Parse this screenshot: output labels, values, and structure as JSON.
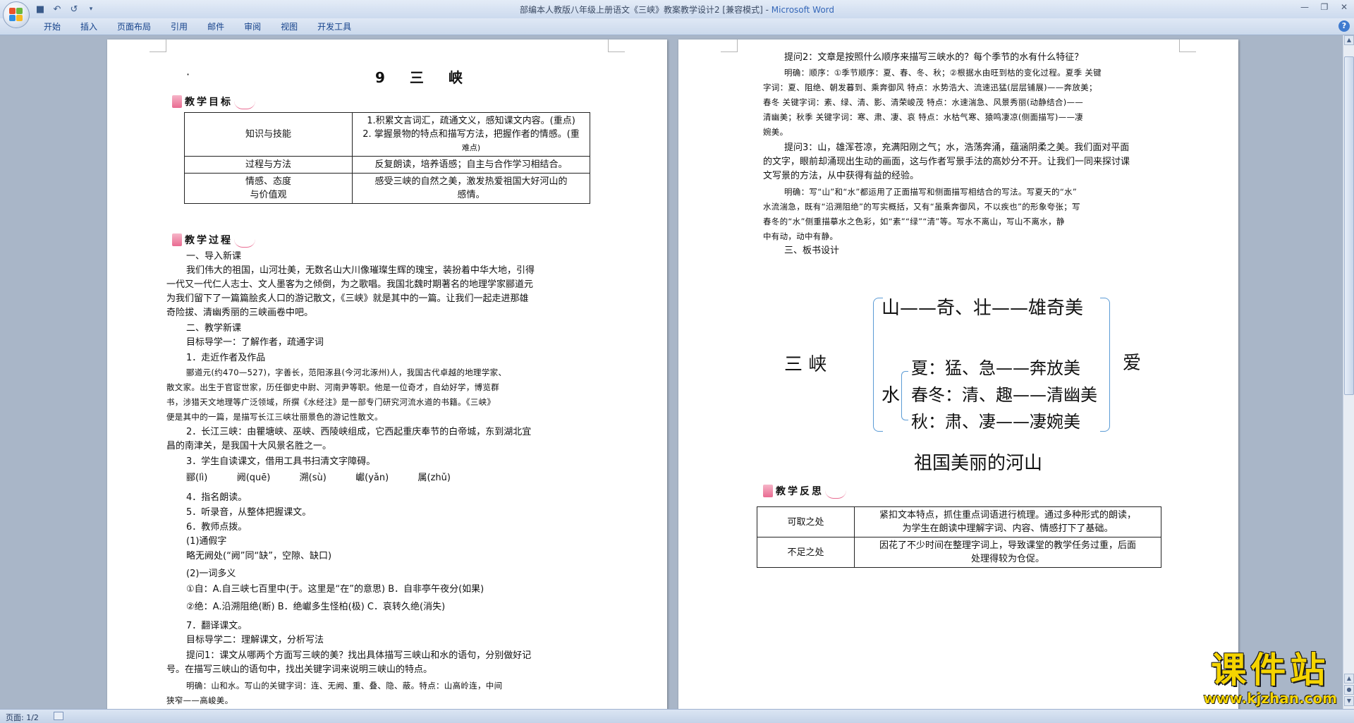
{
  "window": {
    "title": "部编本人教版八年级上册语文《三峡》教案教学设计2 [兼容模式] - ",
    "app": "Microsoft Word"
  },
  "ribbon": {
    "tabs": [
      "开始",
      "插入",
      "页面布局",
      "引用",
      "邮件",
      "审阅",
      "视图",
      "开发工具"
    ]
  },
  "status": {
    "page": "页面: 1/2"
  },
  "watermark": {
    "text": "课件站",
    "url": "www.kjzhan.com"
  },
  "page1": {
    "title": "9  三  峡",
    "sec_goal": "教学目标",
    "goal_table": [
      {
        "k": "知识与技能",
        "v": [
          "1.积累文言词汇，疏通文义，感知课文内容。(重点)",
          "2. 掌握景物的特点和描写方法，把握作者的情感。(重",
          "难点)"
        ]
      },
      {
        "k": "过程与方法",
        "v": [
          "反复朗读，培养语感；自主与合作学习相结合。"
        ]
      },
      {
        "k": "情感、态度",
        "k2": "与价值观",
        "v": [
          "感受三峡的自然之美，激发热爱祖国大好河山的",
          "感情。"
        ]
      }
    ],
    "sec_process": "教学过程",
    "lines": [
      "一、导入新课",
      "我们伟大的祖国，山河壮美，无数名山大川像璀璨生辉的瑰宝，装扮着中华大地，引得",
      "一代又一代仁人志士、文人墨客为之倾倒，为之歌唱。我国北魏时期著名的地理学家郦道元",
      "为我们留下了一篇篇脍炙人口的游记散文，《三峡》就是其中的一篇。让我们一起走进那雄",
      "奇险拔、清幽秀丽的三峡画卷中吧。",
      "二、教学新课",
      "目标导学一：了解作者，疏通字词",
      "1．走近作者及作品",
      "郦道元(约470—527)，字善长，范阳涿县(今河北涿州)人，我国古代卓越的地理学家、",
      "散文家。出生于官宦世家，历任御史中尉、河南尹等职。他是一位奇才，自幼好学，博览群",
      "书，涉猎天文地理等广泛领域，所撰《水经注》是一部专门研究河流水道的书籍。《三峡》",
      "便是其中的一篇，是描写长江三峡壮丽景色的游记性散文。",
      "2．长江三峡：由瞿塘峡、巫峡、西陵峡组成，它西起重庆奉节的白帝城，东到湖北宜",
      "昌的南津关，是我国十大风景名胜之一。",
      "3．学生自读课文，借用工具书扫清文字障碍。",
      "郦(lì)          阙(quē)          溯(sù)          巘(yǎn)          属(zhǔ)",
      "4．指名朗读。",
      "5．听录音，从整体把握课文。",
      "6．教师点拨。",
      "(1)通假字",
      "略无阙处(“阙”同“缺”，空隙、缺口)",
      "(2)一词多义",
      "①自：A.自三峡七百里中(于。这里是“在”的意思)   B．自非亭午夜分(如果)",
      "②绝：A.沿溯阻绝(断)   B．绝巘多生怪柏(极)   C．哀转久绝(消失)",
      "7．翻译课文。",
      "目标导学二：理解课文，分析写法",
      "提问1：课文从哪两个方面写三峡的美？找出具体描写三峡山和水的语句，分别做好记",
      "号。在描写三峡山的语句中，找出关键字词来说明三峡山的特点。",
      "明确：山和水。写山的关键字词：连、无阙、重、叠、隐、蔽。特点：山高岭连，中间",
      "狭窄——高峻美。"
    ]
  },
  "page2": {
    "lines": [
      "提问2：文章是按照什么顺序来描写三峡水的？每个季节的水有什么特征？",
      "明确：顺序：①季节顺序：夏、春、冬、秋；②根据水由旺到枯的变化过程。夏季   关键",
      "字词：夏、阻绝、朝发暮到、乘奔御风   特点：水势浩大、流速迅猛(层层铺展)——奔放美；",
      "春冬   关键字词：素、绿、清、影、清荣峻茂   特点：水速湍急、风景秀丽(动静结合)——",
      "清幽美；秋季   关键字词：寒、肃、凄、哀   特点：水枯气寒、猿鸣凄凉(侧面描写)——凄",
      "婉美。",
      "提问3：山，雄浑苍凉，充满阳刚之气；水，浩荡奔涌，蕴涵阴柔之美。我们面对平面",
      "的文字，眼前却涌现出生动的画面，这与作者写景手法的高妙分不开。让我们一同来探讨课",
      "文写景的方法，从中获得有益的经验。",
      "明确：写“山”和“水”都运用了正面描写和侧面描写相结合的写法。写夏天的“水”",
      "水流湍急，既有“沿溯阻绝”的写实概括，又有“虽乘奔御风，不以疾也”的形象夸张；写",
      "春冬的“水”侧重描摹水之色彩，如“素”“绿”“清”等。写水不离山，写山不离水，静",
      "中有动，动中有静。",
      "三、板书设计"
    ],
    "board": {
      "root": "三  峡",
      "shan": "山——奇、壮——雄奇美",
      "shui": "水",
      "shui_items": [
        "夏：猛、急——奔放美",
        "春冬：清、趣——清幽美",
        "秋：肃、凄——凄婉美"
      ],
      "ai": "爱",
      "bottom": "祖国美丽的河山"
    },
    "sec_reflect": "教学反思",
    "reflect_table": [
      {
        "k": "可取之处",
        "v": [
          "紧扣文本特点，抓住重点词语进行梳理。通过多种形式的朗读，",
          "为学生在朗读中理解字词、内容、情感打下了基础。"
        ]
      },
      {
        "k": "不足之处",
        "v": [
          "因花了不少时间在整理字词上，导致课堂的教学任务过重，后面",
          "处理得较为仓促。"
        ]
      }
    ]
  }
}
